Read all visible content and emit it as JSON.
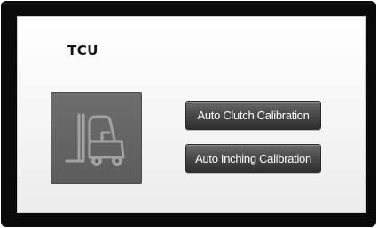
{
  "screen": {
    "title": "TCU"
  },
  "device_tile": {
    "icon": "forklift-icon",
    "colors": {
      "tile": "#666666",
      "icon": "#9a9a9a"
    }
  },
  "actions": {
    "auto_clutch_label": "Auto Clutch Calibration",
    "auto_inching_label": "Auto Inching Calibration"
  }
}
